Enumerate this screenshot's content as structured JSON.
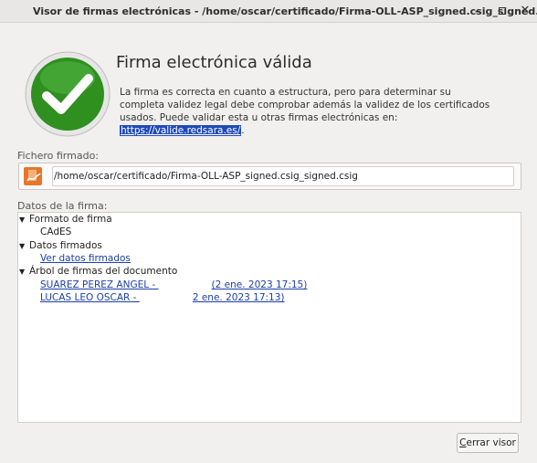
{
  "window": {
    "title": "Visor de firmas electrónicas - /home/oscar/certificado/Firma-OLL-ASP_signed.csig_signed.csig",
    "minimize_glyph": "–",
    "close_glyph": "✕"
  },
  "status": {
    "headline": "Firma electrónica válida",
    "description_part1": "La firma es correcta en cuanto a estructura, pero para determinar su completa validez legal debe comprobar además la validez de los certificados usados. Puede validar esta u otras firmas electrónicas en: ",
    "validation_link": "https://valide.redsara.es/",
    "description_end": ".",
    "badge_icon": "check-icon",
    "badge_color": "#2f8f1f"
  },
  "file_section": {
    "label": "Fichero firmado:",
    "path": "/home/oscar/certificado/Firma-OLL-ASP_signed.csig_signed.csig",
    "file_icon": "document-signature-icon"
  },
  "signature_data": {
    "label": "Datos de la firma:",
    "format_label": "Formato de firma",
    "format_value": "CAdES",
    "signed_data_label": "Datos firmados",
    "signed_data_link": "Ver datos firmados",
    "tree_label": "Árbol de firmas del documento",
    "signer1_name": "SUAREZ PEREZ ANGEL - ",
    "signer1_date": "(2 ene. 2023 17:15)",
    "signer2_name": "LUCAS LEO OSCAR - ",
    "signer2_date": "2 ene. 2023 17:13)"
  },
  "actions": {
    "close_label_mnemonic": "C",
    "close_label_rest": "errar visor"
  }
}
